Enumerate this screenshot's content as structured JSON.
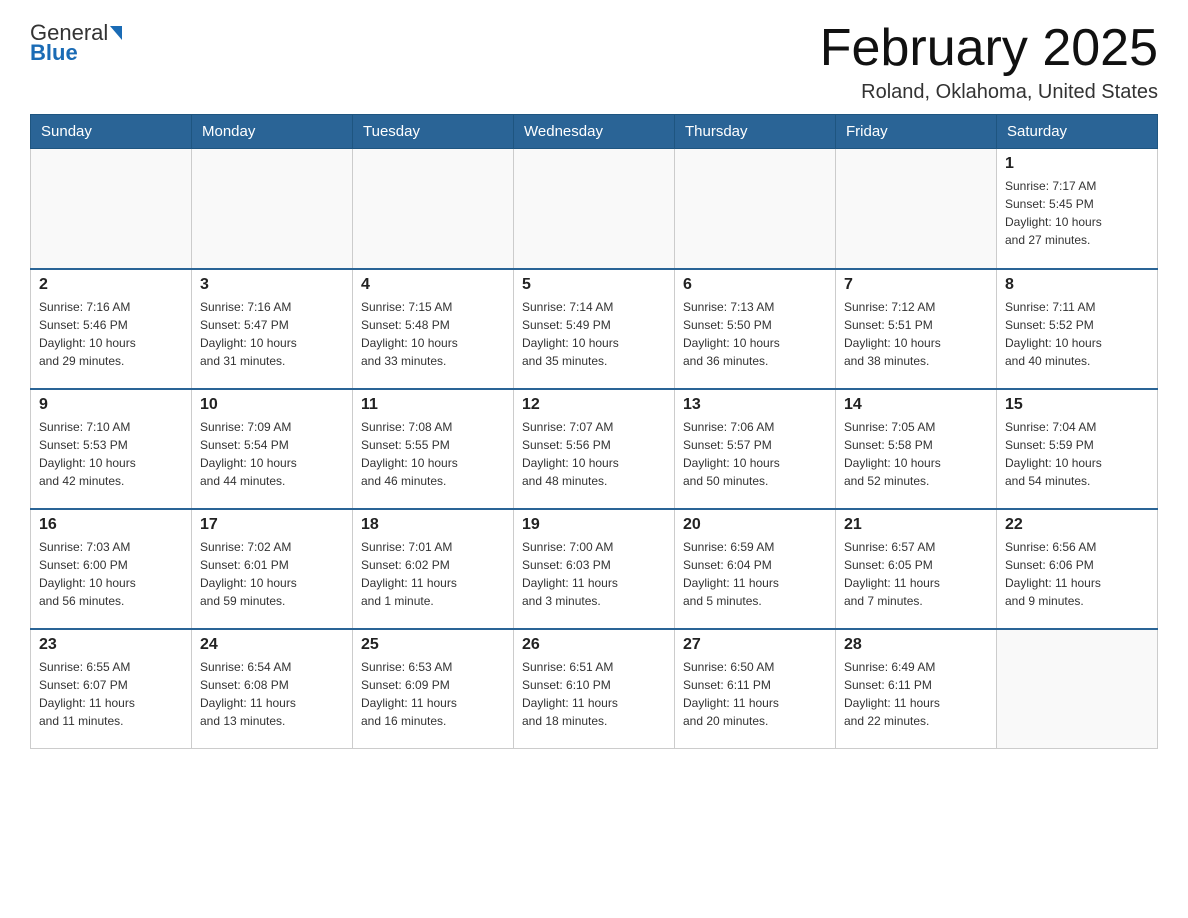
{
  "header": {
    "logo_general": "General",
    "logo_blue": "Blue",
    "month_title": "February 2025",
    "location": "Roland, Oklahoma, United States"
  },
  "days_of_week": [
    "Sunday",
    "Monday",
    "Tuesday",
    "Wednesday",
    "Thursday",
    "Friday",
    "Saturday"
  ],
  "weeks": [
    {
      "days": [
        {
          "date": "",
          "info": ""
        },
        {
          "date": "",
          "info": ""
        },
        {
          "date": "",
          "info": ""
        },
        {
          "date": "",
          "info": ""
        },
        {
          "date": "",
          "info": ""
        },
        {
          "date": "",
          "info": ""
        },
        {
          "date": "1",
          "info": "Sunrise: 7:17 AM\nSunset: 5:45 PM\nDaylight: 10 hours\nand 27 minutes."
        }
      ]
    },
    {
      "days": [
        {
          "date": "2",
          "info": "Sunrise: 7:16 AM\nSunset: 5:46 PM\nDaylight: 10 hours\nand 29 minutes."
        },
        {
          "date": "3",
          "info": "Sunrise: 7:16 AM\nSunset: 5:47 PM\nDaylight: 10 hours\nand 31 minutes."
        },
        {
          "date": "4",
          "info": "Sunrise: 7:15 AM\nSunset: 5:48 PM\nDaylight: 10 hours\nand 33 minutes."
        },
        {
          "date": "5",
          "info": "Sunrise: 7:14 AM\nSunset: 5:49 PM\nDaylight: 10 hours\nand 35 minutes."
        },
        {
          "date": "6",
          "info": "Sunrise: 7:13 AM\nSunset: 5:50 PM\nDaylight: 10 hours\nand 36 minutes."
        },
        {
          "date": "7",
          "info": "Sunrise: 7:12 AM\nSunset: 5:51 PM\nDaylight: 10 hours\nand 38 minutes."
        },
        {
          "date": "8",
          "info": "Sunrise: 7:11 AM\nSunset: 5:52 PM\nDaylight: 10 hours\nand 40 minutes."
        }
      ]
    },
    {
      "days": [
        {
          "date": "9",
          "info": "Sunrise: 7:10 AM\nSunset: 5:53 PM\nDaylight: 10 hours\nand 42 minutes."
        },
        {
          "date": "10",
          "info": "Sunrise: 7:09 AM\nSunset: 5:54 PM\nDaylight: 10 hours\nand 44 minutes."
        },
        {
          "date": "11",
          "info": "Sunrise: 7:08 AM\nSunset: 5:55 PM\nDaylight: 10 hours\nand 46 minutes."
        },
        {
          "date": "12",
          "info": "Sunrise: 7:07 AM\nSunset: 5:56 PM\nDaylight: 10 hours\nand 48 minutes."
        },
        {
          "date": "13",
          "info": "Sunrise: 7:06 AM\nSunset: 5:57 PM\nDaylight: 10 hours\nand 50 minutes."
        },
        {
          "date": "14",
          "info": "Sunrise: 7:05 AM\nSunset: 5:58 PM\nDaylight: 10 hours\nand 52 minutes."
        },
        {
          "date": "15",
          "info": "Sunrise: 7:04 AM\nSunset: 5:59 PM\nDaylight: 10 hours\nand 54 minutes."
        }
      ]
    },
    {
      "days": [
        {
          "date": "16",
          "info": "Sunrise: 7:03 AM\nSunset: 6:00 PM\nDaylight: 10 hours\nand 56 minutes."
        },
        {
          "date": "17",
          "info": "Sunrise: 7:02 AM\nSunset: 6:01 PM\nDaylight: 10 hours\nand 59 minutes."
        },
        {
          "date": "18",
          "info": "Sunrise: 7:01 AM\nSunset: 6:02 PM\nDaylight: 11 hours\nand 1 minute."
        },
        {
          "date": "19",
          "info": "Sunrise: 7:00 AM\nSunset: 6:03 PM\nDaylight: 11 hours\nand 3 minutes."
        },
        {
          "date": "20",
          "info": "Sunrise: 6:59 AM\nSunset: 6:04 PM\nDaylight: 11 hours\nand 5 minutes."
        },
        {
          "date": "21",
          "info": "Sunrise: 6:57 AM\nSunset: 6:05 PM\nDaylight: 11 hours\nand 7 minutes."
        },
        {
          "date": "22",
          "info": "Sunrise: 6:56 AM\nSunset: 6:06 PM\nDaylight: 11 hours\nand 9 minutes."
        }
      ]
    },
    {
      "days": [
        {
          "date": "23",
          "info": "Sunrise: 6:55 AM\nSunset: 6:07 PM\nDaylight: 11 hours\nand 11 minutes."
        },
        {
          "date": "24",
          "info": "Sunrise: 6:54 AM\nSunset: 6:08 PM\nDaylight: 11 hours\nand 13 minutes."
        },
        {
          "date": "25",
          "info": "Sunrise: 6:53 AM\nSunset: 6:09 PM\nDaylight: 11 hours\nand 16 minutes."
        },
        {
          "date": "26",
          "info": "Sunrise: 6:51 AM\nSunset: 6:10 PM\nDaylight: 11 hours\nand 18 minutes."
        },
        {
          "date": "27",
          "info": "Sunrise: 6:50 AM\nSunset: 6:11 PM\nDaylight: 11 hours\nand 20 minutes."
        },
        {
          "date": "28",
          "info": "Sunrise: 6:49 AM\nSunset: 6:11 PM\nDaylight: 11 hours\nand 22 minutes."
        },
        {
          "date": "",
          "info": ""
        }
      ]
    }
  ]
}
